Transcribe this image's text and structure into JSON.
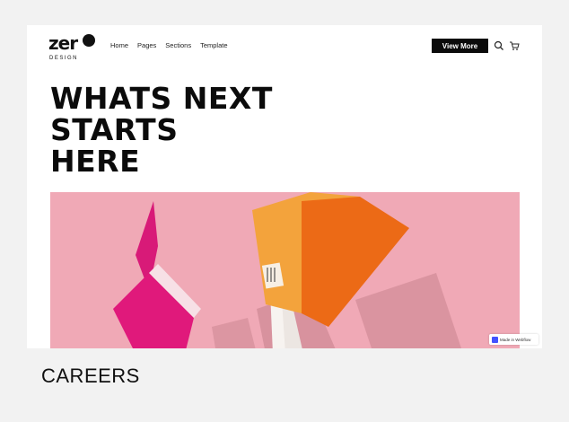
{
  "logo": {
    "mark": "zer",
    "subtitle": "DESIGN"
  },
  "nav": {
    "links": [
      "Home",
      "Pages",
      "Sections",
      "Template"
    ],
    "cta_label": "View More",
    "search_icon": "search-icon",
    "cart_icon": "cart-icon"
  },
  "hero": {
    "title_lines": [
      "WHATS NEXT",
      "STARTS",
      "HERE"
    ],
    "image_alt": "Flying notebooks on pink background"
  },
  "badge": {
    "label": "Made in Webflow"
  },
  "caption": "CAREERS",
  "colors": {
    "accent": "#0b0b0b",
    "hero_bg": "#f0a7b5",
    "notebook_orange": "#f2a13c",
    "notebook_pink": "#e0197b"
  }
}
